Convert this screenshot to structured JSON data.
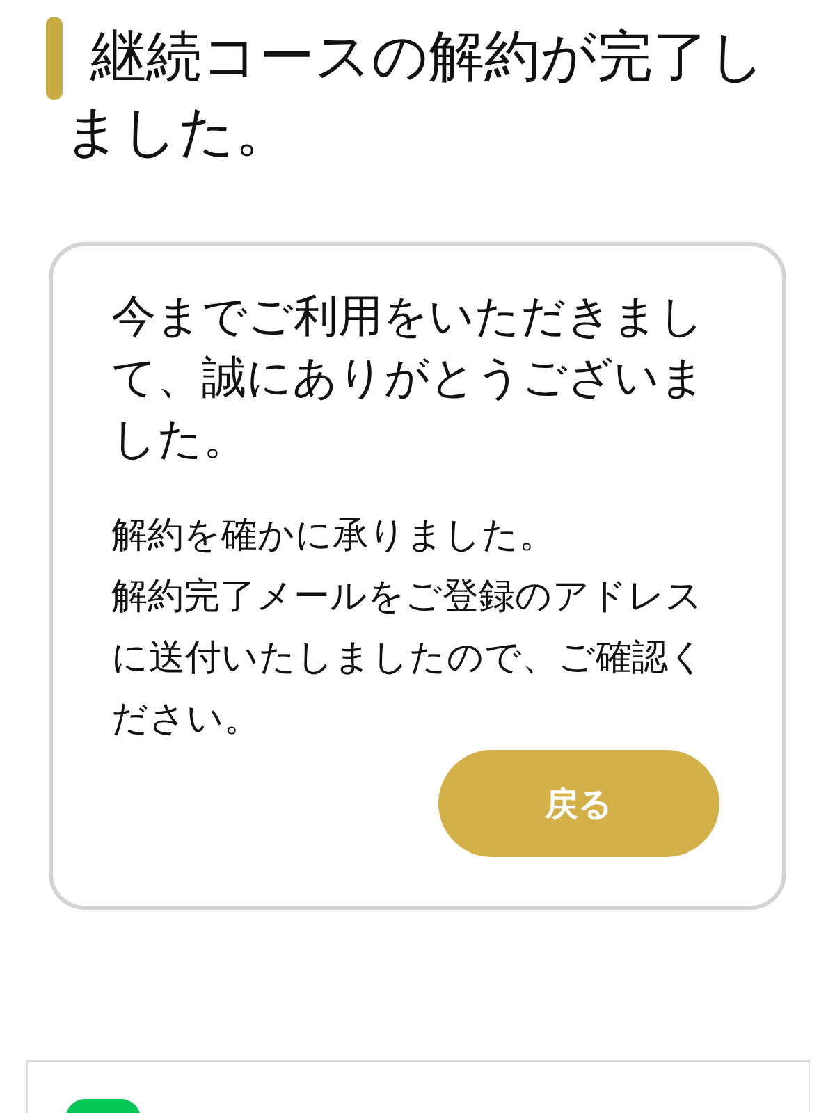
{
  "page_title": "継続コースの解約が完了しました。",
  "card": {
    "heading": "今までご利用をいただきまして、誠にありがとうございました。",
    "paragraphs": [
      "解約を確かに承りました。",
      "解約完了メールをご登録のアドレスに送付いたしましたので、ご確認ください。"
    ],
    "button": "戻る"
  }
}
